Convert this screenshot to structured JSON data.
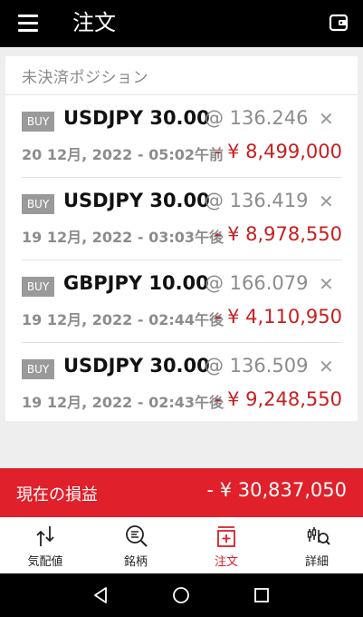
{
  "appbar": {
    "title": "注文",
    "menu_icon": "hamburger-menu-icon",
    "wallet_icon": "wallet-icon"
  },
  "positions_card": {
    "title": "未決済ポジション",
    "positions": [
      {
        "side": "BUY",
        "instrument": "USDJPY 30.00",
        "price": "@ 136.246",
        "date": "20 12月, 2022 - 05:02午前",
        "pnl": "- ¥ 8,499,000"
      },
      {
        "side": "BUY",
        "instrument": "USDJPY 30.00",
        "price": "@ 136.419",
        "date": "19 12月, 2022 - 03:03午後",
        "pnl": "- ¥ 8,978,550"
      },
      {
        "side": "BUY",
        "instrument": "GBPJPY 10.00",
        "price": "@ 166.079",
        "date": "19 12月, 2022 - 02:44午後",
        "pnl": "- ¥ 4,110,950"
      },
      {
        "side": "BUY",
        "instrument": "USDJPY 30.00",
        "price": "@ 136.509",
        "date": "19 12月, 2022 - 02:43午後",
        "pnl": "- ¥ 9,248,550"
      }
    ]
  },
  "summary": {
    "label": "現在の損益",
    "value": "- ¥ 30,837,050",
    "color": "#e0202a"
  },
  "bottom_nav": [
    {
      "label": "気配値",
      "icon": "quotes-arrows-icon",
      "active": false
    },
    {
      "label": "銘柄",
      "icon": "symbols-search-icon",
      "active": false
    },
    {
      "label": "注文",
      "icon": "order-icon",
      "active": true
    },
    {
      "label": "詳細",
      "icon": "chart-detail-icon",
      "active": false
    }
  ],
  "colors": {
    "accent": "#d81e2a",
    "loss": "#c81e1e",
    "appbar": "#000000"
  }
}
